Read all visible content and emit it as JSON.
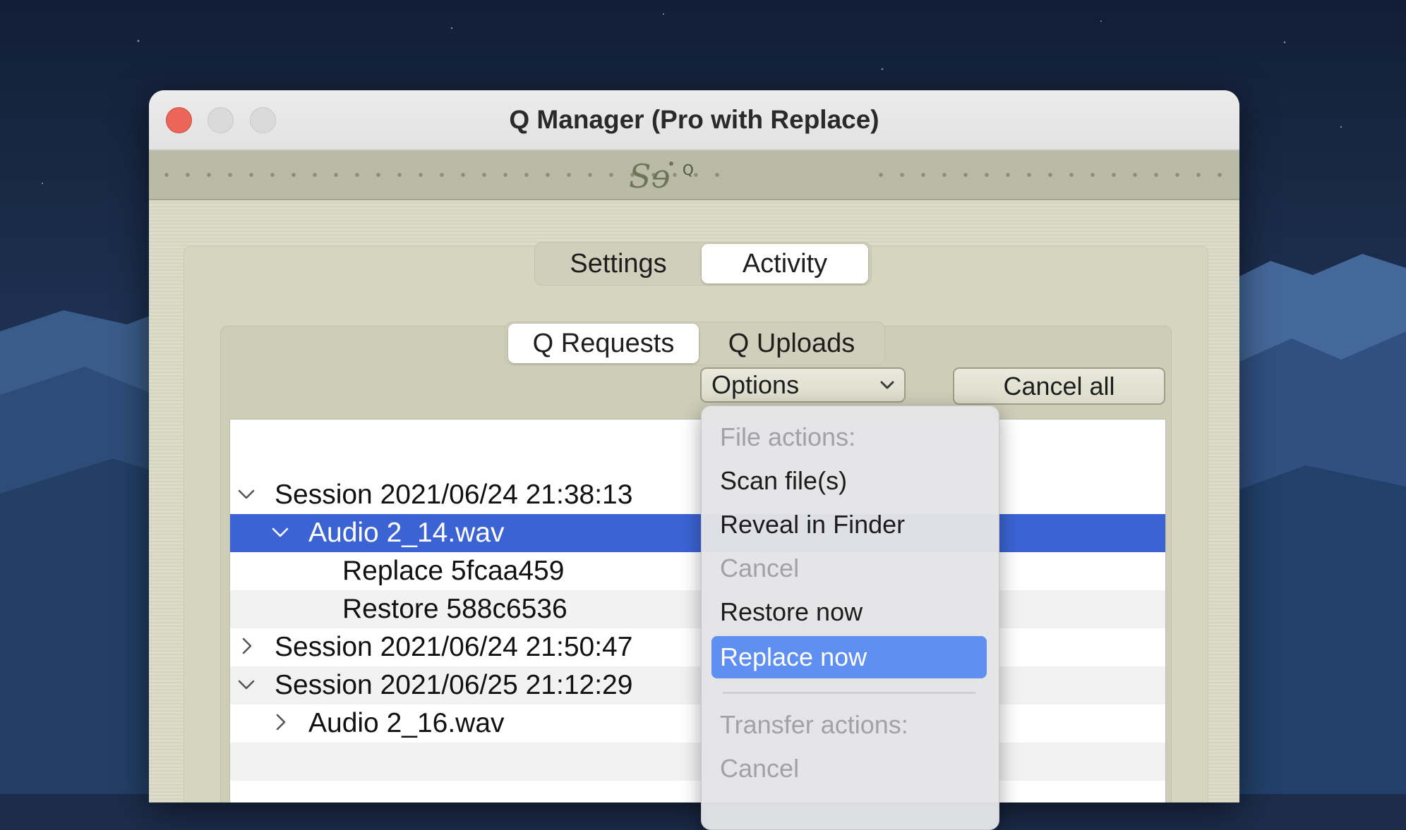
{
  "window": {
    "title": "Q Manager (Pro with Replace)",
    "brand": "Sɘ",
    "brand_sub": "Q"
  },
  "tabs": [
    {
      "label": "Settings",
      "active": false
    },
    {
      "label": "Activity",
      "active": true
    }
  ],
  "subtabs": [
    {
      "label": "Q Requests",
      "active": true
    },
    {
      "label": "Q Uploads",
      "active": false
    }
  ],
  "toolbar": {
    "options_label": "Options",
    "cancel_all_label": "Cancel all"
  },
  "tree": [
    {
      "label": "Session 2021/06/24 21:38:13",
      "level": 0,
      "disclosure": "expanded"
    },
    {
      "label": "Audio 2_14.wav",
      "level": 1,
      "disclosure": "expanded",
      "selected": true
    },
    {
      "label": "Replace 5fcaa459",
      "level": 2,
      "disclosure": "none"
    },
    {
      "label": "Restore 588c6536",
      "level": 2,
      "disclosure": "none"
    },
    {
      "label": "Session 2021/06/24 21:50:47",
      "level": 0,
      "disclosure": "collapsed"
    },
    {
      "label": "Session 2021/06/25 21:12:29",
      "level": 0,
      "disclosure": "expanded"
    },
    {
      "label": "Audio 2_16.wav",
      "level": 1,
      "disclosure": "collapsed"
    }
  ],
  "menu": {
    "items": [
      {
        "label": "File actions:",
        "disabled": true
      },
      {
        "label": "Scan file(s)",
        "disabled": false
      },
      {
        "label": "Reveal in Finder",
        "disabled": false
      },
      {
        "label": "Cancel",
        "disabled": true
      },
      {
        "label": "Restore now",
        "disabled": false
      },
      {
        "label": "Replace now",
        "disabled": false,
        "highlighted": true
      },
      {
        "label": "Transfer actions:",
        "disabled": true,
        "after_separator": true
      },
      {
        "label": "Cancel",
        "disabled": true
      }
    ]
  },
  "colors": {
    "selection": "#3b63d3",
    "menu_highlight": "#5f8ff0",
    "window_body": "#dcdcc8",
    "close_button": "#ec6559"
  }
}
